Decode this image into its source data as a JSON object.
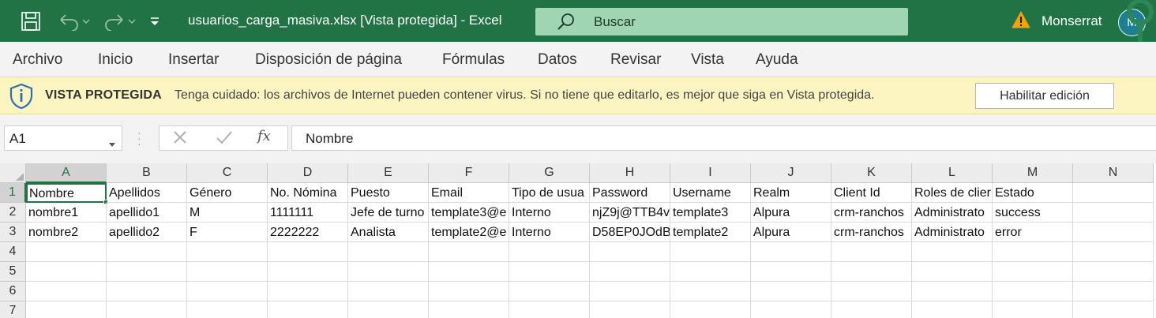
{
  "titlebar": {
    "title": "usuarios_carga_masiva.xlsx  [Vista protegida]  -  Excel",
    "search_placeholder": "Buscar",
    "user_name": "Monserrat",
    "user_initial": "M",
    "accent_color": "#217346"
  },
  "ribbon": {
    "tabs": [
      "Archivo",
      "Inicio",
      "Insertar",
      "Disposición de página",
      "Fórmulas",
      "Datos",
      "Revisar",
      "Vista",
      "Ayuda"
    ]
  },
  "protected_view": {
    "title": "VISTA PROTEGIDA",
    "message": "Tenga cuidado: los archivos de Internet pueden contener virus. Si no tiene que editarlo, es mejor que siga en Vista protegida.",
    "button_label": "Habilitar edición"
  },
  "formula_bar": {
    "name_box": "A1",
    "fx_label": "fx",
    "formula_value": "Nombre"
  },
  "sheet": {
    "columns": [
      "A",
      "B",
      "C",
      "D",
      "E",
      "F",
      "G",
      "H",
      "I",
      "J",
      "K",
      "L",
      "M",
      "N"
    ],
    "row_numbers": [
      "1",
      "2",
      "3",
      "4",
      "5",
      "6",
      "7"
    ],
    "selected_cell": "A1",
    "rows": [
      [
        "Nombre",
        "Apellidos",
        "Género",
        "No. Nómina",
        "Puesto",
        "Email",
        "Tipo de usua",
        "Password",
        "Username",
        "Realm",
        "Client Id",
        "Roles de clier",
        "Estado",
        ""
      ],
      [
        "nombre1",
        "apellido1",
        "M",
        "1111111",
        "Jefe de turno",
        "template3@e",
        "Interno",
        "njZ9j@TTB4v",
        "template3",
        "Alpura",
        "crm-ranchos",
        "Administrato",
        "success",
        ""
      ],
      [
        "nombre2",
        "apellido2",
        "F",
        "2222222",
        "Analista",
        "template2@e",
        "Interno",
        "D58EP0JOdB",
        "template2",
        "Alpura",
        "crm-ranchos",
        "Administrato",
        "error",
        ""
      ],
      [
        "",
        "",
        "",
        "",
        "",
        "",
        "",
        "",
        "",
        "",
        "",
        "",
        "",
        ""
      ],
      [
        "",
        "",
        "",
        "",
        "",
        "",
        "",
        "",
        "",
        "",
        "",
        "",
        "",
        ""
      ],
      [
        "",
        "",
        "",
        "",
        "",
        "",
        "",
        "",
        "",
        "",
        "",
        "",
        "",
        ""
      ],
      [
        "",
        "",
        "",
        "",
        "",
        "",
        "",
        "",
        "",
        "",
        "",
        "",
        "",
        ""
      ]
    ]
  }
}
